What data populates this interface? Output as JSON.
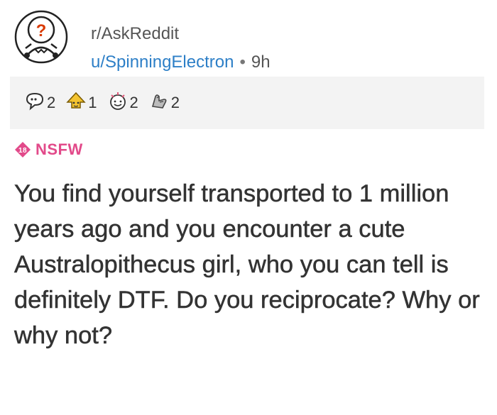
{
  "post": {
    "subreddit": "r/AskReddit",
    "author": "u/SpinningElectron",
    "separator": "•",
    "age": "9h",
    "nsfw_label": "NSFW",
    "nsfw_badge": "18",
    "title": "You find yourself transported to 1 million years ago and you encounter a cute Australopithecus girl, who you can tell is definitely DTF. Do you reciprocate? Why or why not?"
  },
  "awards": [
    {
      "icon": "speech-bubble-award-icon",
      "count": "2"
    },
    {
      "icon": "gold-award-icon",
      "count": "1"
    },
    {
      "icon": "wholesome-award-icon",
      "count": "2"
    },
    {
      "icon": "bravo-award-icon",
      "count": "2"
    }
  ],
  "colors": {
    "nsfw": "#e24a8a",
    "author": "#2d7fc7",
    "awards_bg": "#f3f3f3"
  }
}
